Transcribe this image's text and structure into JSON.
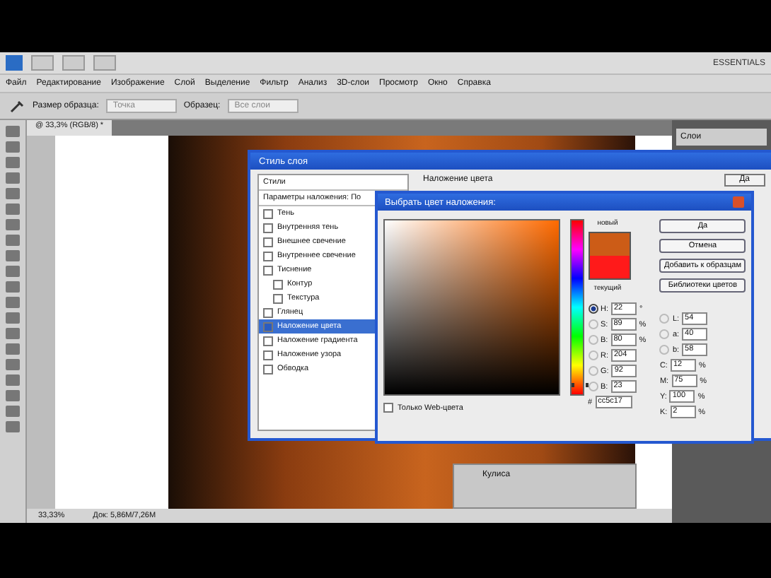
{
  "app_bar": {
    "workspace": "ESSENTIALS"
  },
  "menu": [
    "Файл",
    "Редактирование",
    "Изображение",
    "Слой",
    "Выделение",
    "Фильтр",
    "Анализ",
    "3D-слои",
    "Просмотр",
    "Окно",
    "Справка"
  ],
  "options_bar": {
    "sample_size_label": "Размер образца:",
    "sample_size": "Точка",
    "sample_label": "Образец:",
    "sample": "Все слои"
  },
  "document_tab": {
    "title": "@ 33,3% (RGB/8) *"
  },
  "status_bar": {
    "zoom": "33,33%",
    "doc": "Док: 5,86M/7,26M"
  },
  "right_panel": {
    "title": "Слои",
    "layer": "Кулиса"
  },
  "layer_style": {
    "title": "Стиль слоя",
    "styles_header": "Стили",
    "blending": "Параметры наложения: По",
    "section": "Наложение цвета",
    "ok": "Да",
    "items": [
      {
        "label": "Тень",
        "checked": false,
        "selected": false
      },
      {
        "label": "Внутренняя тень",
        "checked": false,
        "selected": false
      },
      {
        "label": "Внешнее свечение",
        "checked": false,
        "selected": false
      },
      {
        "label": "Внутреннее свечение",
        "checked": false,
        "selected": false
      },
      {
        "label": "Тиснение",
        "checked": false,
        "selected": false,
        "children": [
          {
            "label": "Контур",
            "checked": false,
            "selected": false
          },
          {
            "label": "Текстура",
            "checked": false,
            "selected": false
          }
        ]
      },
      {
        "label": "Глянец",
        "checked": false,
        "selected": false
      },
      {
        "label": "Наложение цвета",
        "checked": true,
        "selected": true
      },
      {
        "label": "Наложение градиента",
        "checked": false,
        "selected": false
      },
      {
        "label": "Наложение узора",
        "checked": false,
        "selected": false
      },
      {
        "label": "Обводка",
        "checked": false,
        "selected": false
      }
    ]
  },
  "color_picker": {
    "title": "Выбрать цвет наложения:",
    "new_label": "новый",
    "current_label": "текущий",
    "swatches": [
      {
        "kind": "new",
        "color": "#cc5c17"
      },
      {
        "kind": "current",
        "color": "#ff1a1a"
      }
    ],
    "hue_slider": {
      "level": 0.06
    },
    "buttons": [
      "Да",
      "Отмена",
      "Добавить к образцам",
      "Библиотеки цветов"
    ],
    "web_only": {
      "label": "Только Web-цвета",
      "checked": false
    },
    "left_fields": [
      {
        "label": "H:",
        "value": "22",
        "unit": "°",
        "selected": true
      },
      {
        "label": "S:",
        "value": "89",
        "unit": "%",
        "selected": false
      },
      {
        "label": "B:",
        "value": "80",
        "unit": "%",
        "selected": false
      },
      {
        "label": "R:",
        "value": "204",
        "selected": false
      },
      {
        "label": "G:",
        "value": "92",
        "selected": false
      },
      {
        "label": "B:",
        "value": "23",
        "selected": false
      }
    ],
    "right_fields": [
      {
        "label": "L:",
        "value": "54",
        "selected": false
      },
      {
        "label": "a:",
        "value": "40",
        "selected": false
      },
      {
        "label": "b:",
        "value": "58",
        "selected": false
      }
    ],
    "cmyk_fields": [
      {
        "label": "C:",
        "value": "12",
        "unit": "%"
      },
      {
        "label": "M:",
        "value": "75",
        "unit": "%"
      },
      {
        "label": "Y:",
        "value": "100",
        "unit": "%"
      },
      {
        "label": "K:",
        "value": "2",
        "unit": "%"
      }
    ],
    "hex_label": "#",
    "hex": "cc5c17"
  }
}
